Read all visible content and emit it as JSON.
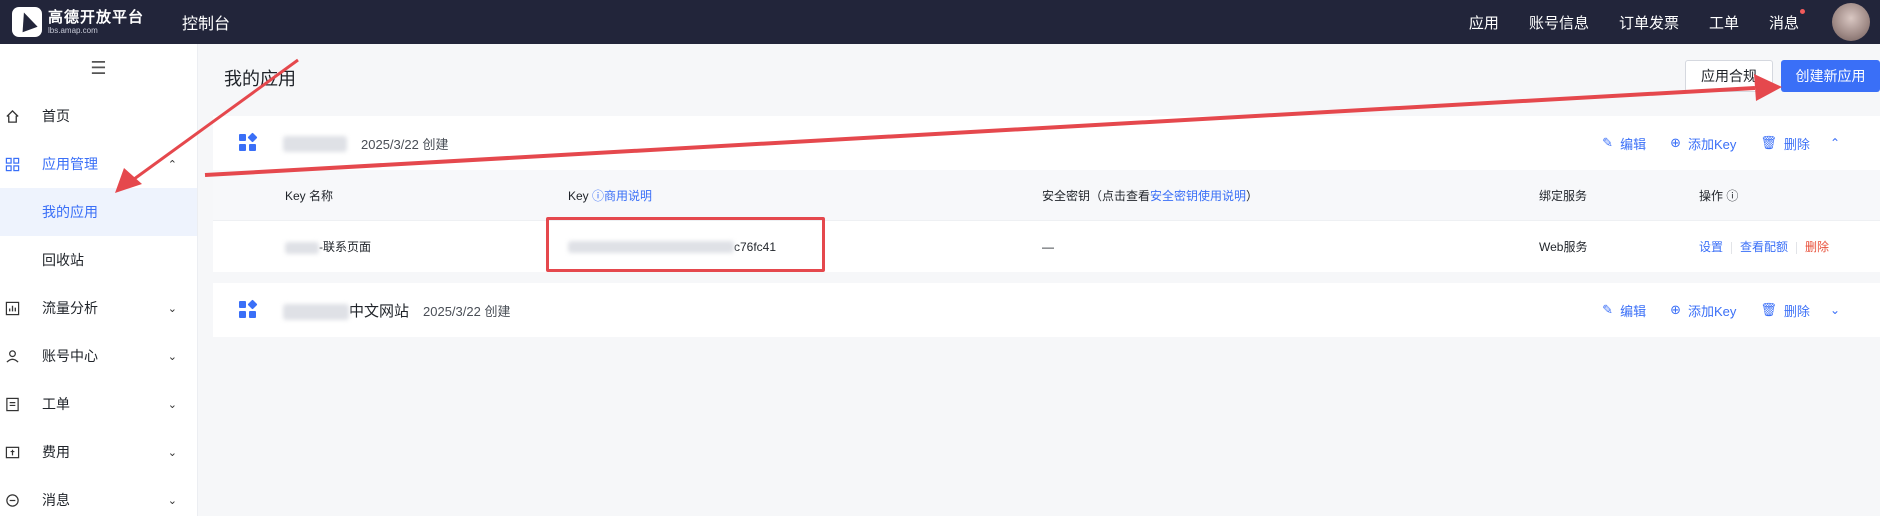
{
  "topbar": {
    "logo_name": "高德开放平台",
    "logo_url": "lbs.amap.com",
    "console": "控制台",
    "nav": [
      "应用",
      "账号信息",
      "订单发票",
      "工单",
      "消息"
    ]
  },
  "sidebar": {
    "items": [
      {
        "label": "首页",
        "icon": "home-icon"
      },
      {
        "label": "应用管理",
        "icon": "grid-icon",
        "expanded": true,
        "children": [
          {
            "label": "我的应用",
            "selected": true
          },
          {
            "label": "回收站"
          }
        ]
      },
      {
        "label": "流量分析",
        "icon": "chart-icon"
      },
      {
        "label": "账号中心",
        "icon": "user-icon"
      },
      {
        "label": "工单",
        "icon": "ticket-icon"
      },
      {
        "label": "费用",
        "icon": "money-icon"
      },
      {
        "label": "消息",
        "icon": "message-icon"
      }
    ]
  },
  "main": {
    "title": "我的应用",
    "compliance_button": "应用合规",
    "create_button": "创建新应用"
  },
  "apps": [
    {
      "name_suffix": "",
      "created": "2025/3/22 创建",
      "actions": {
        "edit": "编辑",
        "add_key": "添加Key",
        "delete": "删除"
      },
      "table": {
        "headers": {
          "key_name": "Key 名称",
          "key": "Key",
          "key_help": "商用说明",
          "secret": "安全密钥（点击查看",
          "secret_link": "安全密钥使用说明",
          "secret_close": "）",
          "service": "绑定服务",
          "ops": "操作"
        },
        "rows": [
          {
            "name_suffix": "-联系页面",
            "key_suffix": "c76fc41",
            "secret": "—",
            "service": "Web服务",
            "op_settings": "设置",
            "op_quota": "查看配额",
            "op_delete": "删除"
          }
        ]
      }
    },
    {
      "name_suffix": "中文网站",
      "created": "2025/3/22 创建",
      "actions": {
        "edit": "编辑",
        "add_key": "添加Key",
        "delete": "删除"
      }
    }
  ],
  "colors": {
    "accent": "#3a6ff7",
    "annotation": "#e5484d",
    "topbar": "#22253a"
  }
}
